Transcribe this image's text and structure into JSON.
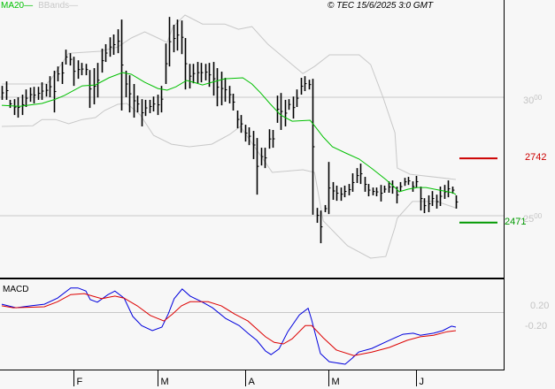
{
  "legend": {
    "ma_label": "MA20",
    "bb_label": "BBands"
  },
  "copyright": "© TEC 15/6/2025 3:0 GMT",
  "colors": {
    "bars": "#000000",
    "ma": "#00c000",
    "bbands": "#c8c8c8",
    "resistance": "#cc0000",
    "support": "#009900",
    "macd": "#0000dd",
    "signal": "#dd0000",
    "grid": "#c8c8c8"
  },
  "chart_data": [
    {
      "type": "ohlc",
      "title": "",
      "ylim": [
        2200,
        3400
      ],
      "y_ticks": [
        {
          "value": 3000,
          "major": "30",
          "minor": "00"
        },
        {
          "value": 2500,
          "major": "25",
          "minor": "00"
        }
      ],
      "x_ticks": [
        {
          "bar": 18,
          "label": "F"
        },
        {
          "bar": 39,
          "label": "M"
        },
        {
          "bar": 61,
          "label": "A"
        },
        {
          "bar": 82,
          "label": "M"
        },
        {
          "bar": 104,
          "label": "J"
        }
      ],
      "levels": [
        {
          "name": "resistance",
          "value": 2742,
          "label": "2742"
        },
        {
          "name": "support",
          "value": 2471,
          "label": "2471"
        }
      ],
      "bars_high_low": [
        [
          3048,
          2989
        ],
        [
          3067,
          2989
        ],
        [
          2989,
          2955
        ],
        [
          2992,
          2925
        ],
        [
          3000,
          2914
        ],
        [
          3011,
          2925
        ],
        [
          3033,
          2959
        ],
        [
          3041,
          2981
        ],
        [
          3044,
          2974
        ],
        [
          3044,
          2989
        ],
        [
          3063,
          2989
        ],
        [
          3056,
          3003
        ],
        [
          3089,
          3000
        ],
        [
          3112,
          2936
        ],
        [
          3130,
          3067
        ],
        [
          3149,
          3056
        ],
        [
          3201,
          3138
        ],
        [
          3186,
          3134
        ],
        [
          3171,
          3048
        ],
        [
          3156,
          3078
        ],
        [
          3145,
          3093
        ],
        [
          3141,
          3093
        ],
        [
          3115,
          2955
        ],
        [
          3123,
          2970
        ],
        [
          3145,
          2999
        ],
        [
          3205,
          3104
        ],
        [
          3224,
          3149
        ],
        [
          3253,
          3171
        ],
        [
          3265,
          3179
        ],
        [
          3287,
          3186
        ],
        [
          3328,
          2944
        ],
        [
          3112,
          3000
        ],
        [
          3093,
          2936
        ],
        [
          3056,
          2914
        ],
        [
          3007,
          2936
        ],
        [
          2992,
          2877
        ],
        [
          2989,
          2921
        ],
        [
          2989,
          2933
        ],
        [
          3003,
          2940
        ],
        [
          3011,
          2925
        ],
        [
          3048,
          2936
        ],
        [
          3227,
          3056
        ],
        [
          3339,
          3130
        ],
        [
          3306,
          3190
        ],
        [
          3328,
          3197
        ],
        [
          3324,
          3182
        ],
        [
          3250,
          3033
        ],
        [
          3141,
          3037
        ],
        [
          3141,
          3059
        ],
        [
          3149,
          3059
        ],
        [
          3145,
          3063
        ],
        [
          3141,
          3071
        ],
        [
          3145,
          3044
        ],
        [
          3149,
          3007
        ],
        [
          3123,
          2962
        ],
        [
          3108,
          2966
        ],
        [
          3082,
          2981
        ],
        [
          3048,
          2974
        ],
        [
          3015,
          2944
        ],
        [
          2944,
          2869
        ],
        [
          2925,
          2850
        ],
        [
          2884,
          2813
        ],
        [
          2873,
          2798
        ],
        [
          2858,
          2739
        ],
        [
          2828,
          2589
        ],
        [
          2787,
          2712
        ],
        [
          2787,
          2701
        ],
        [
          2865,
          2783
        ],
        [
          2862,
          2787
        ],
        [
          3007,
          2892
        ],
        [
          3018,
          2862
        ],
        [
          2989,
          2877
        ],
        [
          2992,
          2947
        ],
        [
          3003,
          2910
        ],
        [
          3033,
          2959
        ],
        [
          3082,
          3011
        ],
        [
          3089,
          3026
        ],
        [
          3074,
          3033
        ],
        [
          3078,
          2504
        ],
        [
          2533,
          2470
        ],
        [
          2522,
          2384
        ],
        [
          2545,
          2515
        ],
        [
          2727,
          2507
        ],
        [
          2642,
          2567
        ],
        [
          2627,
          2563
        ],
        [
          2619,
          2563
        ],
        [
          2627,
          2578
        ],
        [
          2634,
          2586
        ],
        [
          2679,
          2601
        ],
        [
          2701,
          2638
        ],
        [
          2720,
          2634
        ],
        [
          2664,
          2601
        ],
        [
          2634,
          2582
        ],
        [
          2619,
          2586
        ],
        [
          2619,
          2582
        ],
        [
          2630,
          2560
        ],
        [
          2627,
          2597
        ],
        [
          2645,
          2597
        ],
        [
          2649,
          2593
        ],
        [
          2623,
          2552
        ],
        [
          2642,
          2604
        ],
        [
          2660,
          2626
        ],
        [
          2664,
          2630
        ],
        [
          2645,
          2601
        ],
        [
          2668,
          2619
        ],
        [
          2623,
          2522
        ],
        [
          2574,
          2511
        ],
        [
          2586,
          2515
        ],
        [
          2604,
          2541
        ],
        [
          2589,
          2530
        ],
        [
          2623,
          2541
        ],
        [
          2630,
          2571
        ],
        [
          2649,
          2578
        ],
        [
          2623,
          2593
        ],
        [
          2586,
          2530
        ]
      ],
      "ma20": [
        [
          0,
          2966
        ],
        [
          4.5,
          2962
        ],
        [
          10.1,
          2974
        ],
        [
          13.5,
          2992
        ],
        [
          15.7,
          3007
        ],
        [
          20.2,
          3048
        ],
        [
          23.5,
          3052
        ],
        [
          26.9,
          3082
        ],
        [
          30.3,
          3104
        ],
        [
          32.5,
          3097
        ],
        [
          35.9,
          3063
        ],
        [
          39.2,
          3037
        ],
        [
          41.5,
          3030
        ],
        [
          43.7,
          3044
        ],
        [
          46.4,
          3071
        ],
        [
          48.2,
          3063
        ],
        [
          50.4,
          3052
        ],
        [
          52.7,
          3063
        ],
        [
          56,
          3078
        ],
        [
          60.5,
          3082
        ],
        [
          62.8,
          3056
        ],
        [
          65,
          3018
        ],
        [
          67.3,
          2974
        ],
        [
          70,
          2925
        ],
        [
          72.9,
          2899
        ],
        [
          77.4,
          2903
        ],
        [
          78.5,
          2880
        ],
        [
          80.7,
          2832
        ],
        [
          83,
          2791
        ],
        [
          86.3,
          2765
        ],
        [
          89.7,
          2739
        ],
        [
          93,
          2698
        ],
        [
          96.4,
          2653
        ],
        [
          98.7,
          2619
        ],
        [
          99.8,
          2601
        ],
        [
          102,
          2612
        ],
        [
          104.3,
          2619
        ],
        [
          106.5,
          2619
        ],
        [
          109.9,
          2608
        ],
        [
          113.2,
          2597
        ],
        [
          114,
          2589
        ]
      ],
      "bb_upper": [
        [
          0,
          3056
        ],
        [
          11.2,
          3056
        ],
        [
          12.3,
          3074
        ],
        [
          16.8,
          3186
        ],
        [
          24.7,
          3194
        ],
        [
          29.1,
          3212
        ],
        [
          32.5,
          3250
        ],
        [
          35.9,
          3276
        ],
        [
          39.2,
          3250
        ],
        [
          41.5,
          3231
        ],
        [
          43,
          3298
        ],
        [
          46,
          3347
        ],
        [
          50.4,
          3309
        ],
        [
          56,
          3309
        ],
        [
          59.4,
          3287
        ],
        [
          62.8,
          3298
        ],
        [
          66.8,
          3224
        ],
        [
          75.6,
          3100
        ],
        [
          78.5,
          3130
        ],
        [
          82.3,
          3179
        ],
        [
          89.7,
          3179
        ],
        [
          92.6,
          3138
        ],
        [
          95.7,
          3000
        ],
        [
          98.7,
          2850
        ],
        [
          99.3,
          2701
        ],
        [
          102.5,
          2675
        ],
        [
          114,
          2653
        ]
      ],
      "bb_lower": [
        [
          0,
          2877
        ],
        [
          7.8,
          2880
        ],
        [
          10.1,
          2906
        ],
        [
          13.5,
          2906
        ],
        [
          16.8,
          2888
        ],
        [
          20.2,
          2906
        ],
        [
          23.5,
          2914
        ],
        [
          25.8,
          2944
        ],
        [
          29.1,
          2970
        ],
        [
          31.4,
          2974
        ],
        [
          34.8,
          2925
        ],
        [
          38.1,
          2839
        ],
        [
          42.6,
          2802
        ],
        [
          47.1,
          2791
        ],
        [
          52.7,
          2802
        ],
        [
          57.2,
          2843
        ],
        [
          59.9,
          2877
        ],
        [
          60.5,
          2862
        ],
        [
          67.9,
          2683
        ],
        [
          75.6,
          2694
        ],
        [
          78.5,
          2683
        ],
        [
          80.7,
          2478
        ],
        [
          86.8,
          2373
        ],
        [
          92.6,
          2321
        ],
        [
          96.4,
          2328
        ],
        [
          98.7,
          2451
        ],
        [
          99.3,
          2489
        ],
        [
          103.1,
          2560
        ],
        [
          109.2,
          2560
        ],
        [
          114,
          2533
        ]
      ]
    },
    {
      "type": "line",
      "title": "MACD",
      "ylim": [
        -1.05,
        0.7
      ],
      "y_ticks": [
        {
          "value": 0.2,
          "label": "0.20"
        },
        {
          "value": -0.2,
          "label": "-0.20"
        }
      ],
      "series": [
        {
          "name": "macd",
          "points": [
            [
              0,
              0.25
            ],
            [
              3.6,
              0.18
            ],
            [
              7.3,
              0.22
            ],
            [
              10.7,
              0.25
            ],
            [
              14,
              0.37
            ],
            [
              17.3,
              0.57
            ],
            [
              19.1,
              0.57
            ],
            [
              21.1,
              0.51
            ],
            [
              22.2,
              0.34
            ],
            [
              24,
              0.29
            ],
            [
              26.7,
              0.44
            ],
            [
              28.4,
              0.51
            ],
            [
              30.7,
              0.37
            ],
            [
              32.9,
              0.01
            ],
            [
              35.1,
              -0.17
            ],
            [
              37.8,
              -0.27
            ],
            [
              40.2,
              -0.2
            ],
            [
              41.8,
              0.06
            ],
            [
              43.3,
              0.36
            ],
            [
              45.3,
              0.55
            ],
            [
              47.3,
              0.41
            ],
            [
              50.2,
              0.3
            ],
            [
              52.9,
              0.18
            ],
            [
              56.2,
              -0.03
            ],
            [
              59.6,
              -0.17
            ],
            [
              61.8,
              -0.32
            ],
            [
              64,
              -0.46
            ],
            [
              66.2,
              -0.67
            ],
            [
              67.6,
              -0.74
            ],
            [
              69.6,
              -0.63
            ],
            [
              71.8,
              -0.29
            ],
            [
              74.7,
              0.04
            ],
            [
              76.9,
              0.17
            ],
            [
              77.8,
              -0.06
            ],
            [
              80,
              -0.72
            ],
            [
              82.2,
              -0.88
            ],
            [
              86.2,
              -0.93
            ],
            [
              88,
              -0.81
            ],
            [
              89.6,
              -0.69
            ],
            [
              92.9,
              -0.62
            ],
            [
              97.3,
              -0.46
            ],
            [
              100.7,
              -0.34
            ],
            [
              103.3,
              -0.32
            ],
            [
              105.1,
              -0.36
            ],
            [
              108.4,
              -0.32
            ],
            [
              110.7,
              -0.27
            ],
            [
              112.9,
              -0.18
            ],
            [
              114,
              -0.2
            ]
          ]
        },
        {
          "name": "signal",
          "points": [
            [
              0,
              0.22
            ],
            [
              2.9,
              0.18
            ],
            [
              10.7,
              0.2
            ],
            [
              14,
              0.3
            ],
            [
              17.3,
              0.44
            ],
            [
              20.7,
              0.46
            ],
            [
              25.1,
              0.36
            ],
            [
              28.4,
              0.41
            ],
            [
              30.7,
              0.37
            ],
            [
              34,
              0.22
            ],
            [
              37.3,
              0.03
            ],
            [
              40.7,
              -0.08
            ],
            [
              42.9,
              0.06
            ],
            [
              45.1,
              0.22
            ],
            [
              47.3,
              0.3
            ],
            [
              51.8,
              0.3
            ],
            [
              55.1,
              0.22
            ],
            [
              58.4,
              0.06
            ],
            [
              61.8,
              -0.08
            ],
            [
              66.2,
              -0.39
            ],
            [
              68.4,
              -0.5
            ],
            [
              70.7,
              -0.53
            ],
            [
              72.9,
              -0.43
            ],
            [
              76.2,
              -0.17
            ],
            [
              77.8,
              -0.17
            ],
            [
              80.7,
              -0.41
            ],
            [
              84,
              -0.65
            ],
            [
              88.4,
              -0.76
            ],
            [
              92.9,
              -0.69
            ],
            [
              97.3,
              -0.6
            ],
            [
              101.8,
              -0.46
            ],
            [
              105.1,
              -0.39
            ],
            [
              108.4,
              -0.36
            ],
            [
              111.8,
              -0.29
            ],
            [
              114,
              -0.27
            ]
          ]
        }
      ]
    }
  ]
}
